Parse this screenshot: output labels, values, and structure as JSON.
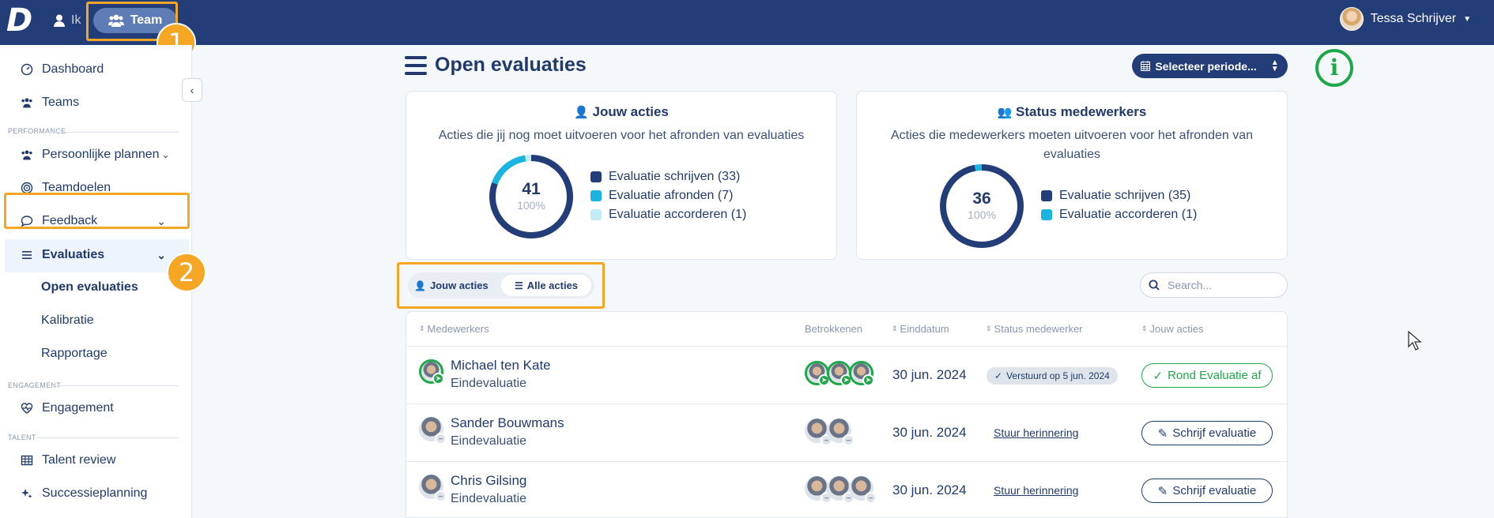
{
  "topbar": {
    "logo": "D",
    "nav_ik": "Ik",
    "nav_team": "Team",
    "user_name": "Tessa Schrijver"
  },
  "annotations": {
    "badge1": "1",
    "badge2": "2"
  },
  "sidebar": {
    "items": [
      {
        "label": "Dashboard",
        "icon": "gauge-icon"
      },
      {
        "label": "Teams",
        "icon": "users-icon"
      }
    ],
    "section_performance": "PERFORMANCE",
    "performance_items": [
      {
        "label": "Persoonlijke plannen",
        "icon": "users-icon"
      },
      {
        "label": "Teamdoelen",
        "icon": "target-icon"
      },
      {
        "label": "Feedback",
        "icon": "comment-icon"
      },
      {
        "label": "Evaluaties",
        "icon": "list-icon"
      }
    ],
    "evaluaties_sub": [
      "Open evaluaties",
      "Kalibratie",
      "Rapportage"
    ],
    "section_engagement": "ENGAGEMENT",
    "engagement_item": "Engagement",
    "section_talent": "TALENT",
    "talent_items": [
      "Talent review",
      "Successieplanning"
    ]
  },
  "main": {
    "title": "Open evaluaties",
    "period_button": "Selecteer periode...",
    "card_left": {
      "title": "Jouw acties",
      "desc": "Acties die jij nog moet uitvoeren voor het afronden van evaluaties",
      "total": "41",
      "percent": "100%",
      "legend": [
        {
          "label": "Evaluatie schrijven (33)",
          "color": "#233d78"
        },
        {
          "label": "Evaluatie afronden (7)",
          "color": "#19b5e0"
        },
        {
          "label": "Evaluatie accorderen (1)",
          "color": "#c3ecf6"
        }
      ]
    },
    "card_right": {
      "title": "Status medewerkers",
      "desc": "Acties die medewerkers moeten uitvoeren voor het afronden van evaluaties",
      "total": "36",
      "percent": "100%",
      "legend": [
        {
          "label": "Evaluatie schrijven (35)",
          "color": "#233d78"
        },
        {
          "label": "Evaluatie accorderen (1)",
          "color": "#19b5e0"
        }
      ]
    },
    "toggle": {
      "option_a": "Jouw acties",
      "option_b": "Alle acties"
    },
    "search_placeholder": "Search...",
    "table": {
      "headers": [
        "Medewerkers",
        "Betrokkenen",
        "Einddatum",
        "Status medewerker",
        "Jouw acties"
      ],
      "rows": [
        {
          "name": "Michael ten Kate",
          "type": "Eindevaluatie",
          "date": "30 jun. 2024",
          "status": "Verstuurd op 5 jun. 2024",
          "action": "Rond Evaluatie af"
        },
        {
          "name": "Sander Bouwmans",
          "type": "Eindevaluatie",
          "date": "30 jun. 2024",
          "status": "Stuur herinnering",
          "action": "Schrijf evaluatie"
        },
        {
          "name": "Chris Gilsing",
          "type": "Eindevaluatie",
          "date": "30 jun. 2024",
          "status": "Stuur herinnering",
          "action": "Schrijf evaluatie"
        }
      ]
    }
  }
}
